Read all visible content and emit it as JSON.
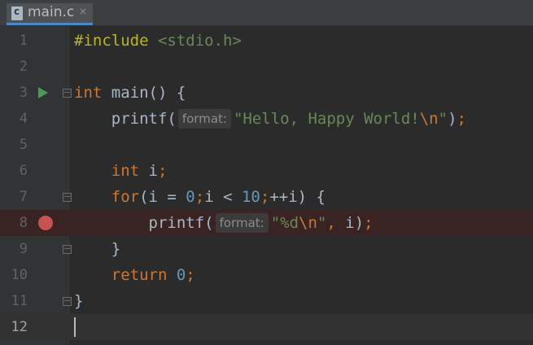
{
  "tab": {
    "filename": "main.c",
    "close_glyph": "×",
    "icon": "c-file-icon"
  },
  "hint_label": "format:",
  "lines": [
    {
      "n": "1",
      "segments": [
        {
          "t": "#include ",
          "c": "pp"
        },
        {
          "t": "<stdio.h>",
          "c": "inc"
        }
      ]
    },
    {
      "n": "2",
      "segments": []
    },
    {
      "n": "3",
      "segments": [
        {
          "t": "int ",
          "c": "kw"
        },
        {
          "t": "main",
          "c": "fn"
        },
        {
          "t": "() {",
          "c": ""
        }
      ]
    },
    {
      "n": "4",
      "segments": [
        {
          "t": "    printf(",
          "c": ""
        },
        {
          "hint": true
        },
        {
          "t": "\"Hello, Happy World!",
          "c": "str"
        },
        {
          "t": "\\n",
          "c": "esc"
        },
        {
          "t": "\"",
          "c": "str"
        },
        {
          "t": ")",
          "c": ""
        },
        {
          "t": ";",
          "c": "kw"
        }
      ]
    },
    {
      "n": "5",
      "segments": []
    },
    {
      "n": "6",
      "segments": [
        {
          "t": "    ",
          "c": ""
        },
        {
          "t": "int ",
          "c": "kw"
        },
        {
          "t": "i",
          "c": ""
        },
        {
          "t": ";",
          "c": "kw"
        }
      ]
    },
    {
      "n": "7",
      "segments": [
        {
          "t": "    ",
          "c": ""
        },
        {
          "t": "for",
          "c": "kw"
        },
        {
          "t": "(i = ",
          "c": ""
        },
        {
          "t": "0",
          "c": "num"
        },
        {
          "t": ";",
          "c": "kw"
        },
        {
          "t": "i < ",
          "c": ""
        },
        {
          "t": "10",
          "c": "num"
        },
        {
          "t": ";",
          "c": "kw"
        },
        {
          "t": "++i) {",
          "c": ""
        }
      ]
    },
    {
      "n": "8",
      "segments": [
        {
          "t": "        printf(",
          "c": ""
        },
        {
          "hint": true
        },
        {
          "t": "\"%d",
          "c": "str"
        },
        {
          "t": "\\n",
          "c": "esc"
        },
        {
          "t": "\"",
          "c": "str"
        },
        {
          "t": ", ",
          "c": "kw"
        },
        {
          "t": "i)",
          "c": ""
        },
        {
          "t": ";",
          "c": "kw"
        }
      ]
    },
    {
      "n": "9",
      "segments": [
        {
          "t": "    }",
          "c": ""
        }
      ]
    },
    {
      "n": "10",
      "segments": [
        {
          "t": "    ",
          "c": ""
        },
        {
          "t": "return ",
          "c": "kw"
        },
        {
          "t": "0",
          "c": "num"
        },
        {
          "t": ";",
          "c": "kw"
        }
      ]
    },
    {
      "n": "11",
      "segments": [
        {
          "t": "}",
          "c": ""
        }
      ]
    },
    {
      "n": "12",
      "segments": []
    }
  ],
  "colors": {
    "background": "#2b2b2b",
    "gutter": "#313335",
    "keyword": "#cc7832",
    "string": "#6a8759",
    "number": "#6897bb",
    "preprocessor": "#bbb529",
    "breakpoint": "#c75450",
    "run_gutter_icon": "#499c54"
  },
  "gutter_icons": {
    "run_line": "3",
    "breakpoint_line": "8",
    "fold_open_lines": [
      "3",
      "7"
    ],
    "fold_close_lines": [
      "9",
      "11"
    ],
    "caret_line": "12"
  }
}
